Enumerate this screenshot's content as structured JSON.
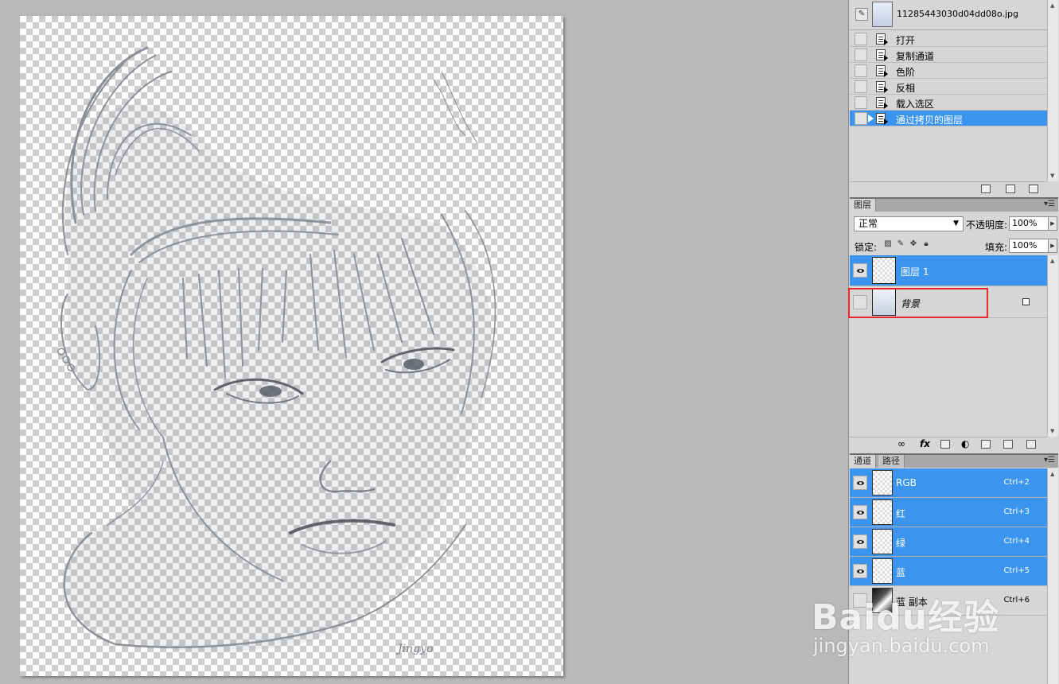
{
  "history": {
    "snapshot_label": "11285443030d04dd08o.jpg",
    "states": [
      {
        "label": "打开",
        "active": false
      },
      {
        "label": "复制通道",
        "active": false
      },
      {
        "label": "色阶",
        "active": false
      },
      {
        "label": "反相",
        "active": false
      },
      {
        "label": "载入选区",
        "active": false
      },
      {
        "label": "通过拷贝的图层",
        "active": true
      }
    ]
  },
  "layers": {
    "tab_label": "图层",
    "blend_mode": "正常",
    "opacity_label": "不透明度:",
    "opacity_value": "100%",
    "lock_label": "锁定:",
    "fill_label": "填充:",
    "fill_value": "100%",
    "items": [
      {
        "name": "图层 1",
        "active": true,
        "visible": true
      },
      {
        "name": "背景",
        "active": false,
        "visible": false,
        "locked": true
      }
    ]
  },
  "channels": {
    "tab_label": "通道",
    "tab2_label": "路径",
    "items": [
      {
        "name": "RGB",
        "shortcut": "Ctrl+2",
        "active": true,
        "visible": true
      },
      {
        "name": "红",
        "shortcut": "Ctrl+3",
        "active": true,
        "visible": true
      },
      {
        "name": "绿",
        "shortcut": "Ctrl+4",
        "active": true,
        "visible": true
      },
      {
        "name": "蓝",
        "shortcut": "Ctrl+5",
        "active": true,
        "visible": true
      },
      {
        "name": "蓝 副本",
        "shortcut": "Ctrl+6",
        "active": false,
        "visible": false
      }
    ]
  },
  "canvas": {
    "signature": "Jingyo"
  },
  "watermark": {
    "brand": "Baidu经验",
    "url": "jingyan.baidu.com"
  },
  "colors": {
    "selection": "#3b95ef",
    "highlight_box": "#e8262b",
    "panel_bg": "#d6d6d6",
    "workspace_bg": "#b9b9b9"
  }
}
